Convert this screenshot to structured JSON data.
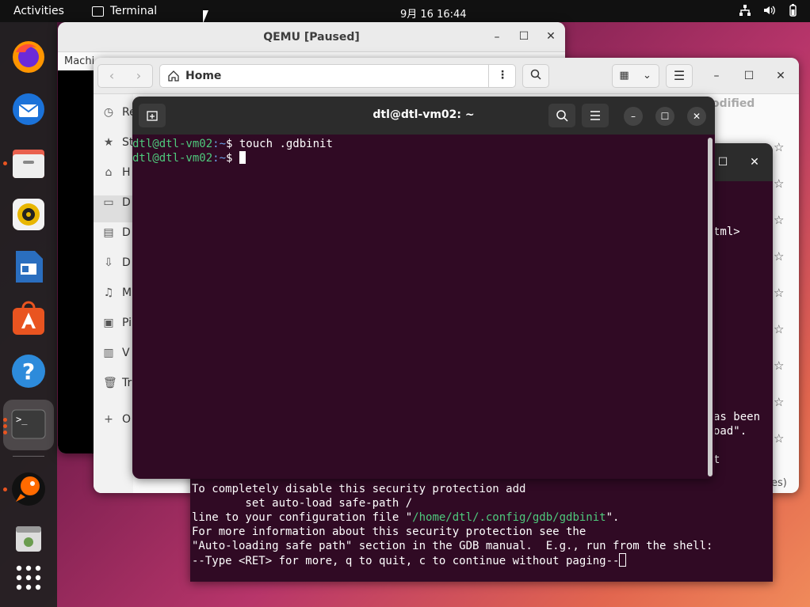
{
  "topbar": {
    "activities": "Activities",
    "app_name": "Terminal",
    "clock": "9月 16 16:44"
  },
  "dock": {
    "items": [
      "firefox-icon",
      "thunderbird-icon",
      "files-icon",
      "rhythmbox-icon",
      "libreoffice-writer-icon",
      "app-center-icon",
      "help-icon",
      "terminal-icon",
      "qemu-icon",
      "trash-icon",
      "show-apps-icon"
    ]
  },
  "qemu": {
    "title": "QEMU [Paused]",
    "menu_label": "Machi"
  },
  "files": {
    "path_label": "Home",
    "sidebar": [
      {
        "icon": "recent-icon",
        "label": "Re"
      },
      {
        "icon": "starred-icon",
        "label": "St"
      },
      {
        "icon": "home-icon",
        "label": "H"
      },
      {
        "icon": "desktop-icon",
        "label": "D"
      },
      {
        "icon": "documents-icon",
        "label": "D"
      },
      {
        "icon": "downloads-icon",
        "label": "D"
      },
      {
        "icon": "music-icon",
        "label": "M"
      },
      {
        "icon": "pictures-icon",
        "label": "Pi"
      },
      {
        "icon": "videos-icon",
        "label": "V"
      },
      {
        "icon": "trash-icon",
        "label": "Tr"
      },
      {
        "icon": "plus-icon",
        "label": "O"
      }
    ],
    "column_header": "odified",
    "bottom_text": "es)"
  },
  "gdb_terminal": {
    "peek_html": "tml>",
    "peek_been": "as been",
    "peek_load": "oad\".",
    "peek_t": "t",
    "lines": [
      "To completely disable this security protection add",
      "        set auto-load safe-path /",
      "line to your configuration file \"",
      "For more information about this security protection see the",
      "\"Auto-loading safe path\" section in the GDB manual.  E.g., run from the shell:",
      "--Type <RET> for more, q to quit, c to continue without paging--"
    ],
    "config_path": "/home/dtl/.config/gdb/gdbinit",
    "config_suffix": "\"."
  },
  "terminal": {
    "title": "dtl@dtl-vm02: ~",
    "prompt_user": "dtl@dtl-vm02",
    "prompt_path": ":~",
    "prompt_symbol": "$ ",
    "command1": "touch .gdbinit"
  }
}
